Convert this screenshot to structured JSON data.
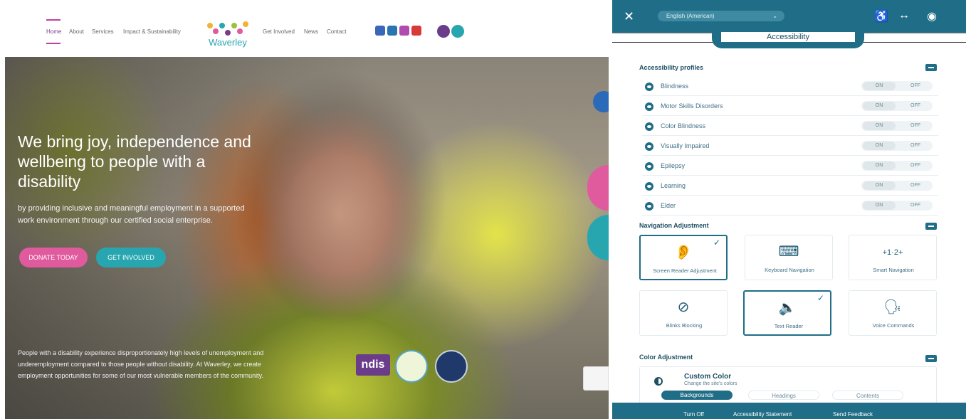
{
  "site": {
    "nav_left": [
      "Home",
      "About",
      "Services",
      "Impact & Sustainability"
    ],
    "nav_right": [
      "Get Involved",
      "News",
      "Contact"
    ],
    "logo_text": "Waverley",
    "hero": {
      "title": "We bring joy, independence and wellbeing to people with a disability",
      "subtitle": "by providing inclusive and meaningful employment in a supported work environment through our certified social enterprise.",
      "donate_label": "DONATE TODAY",
      "involved_label": "GET INVOLVED",
      "bottom_text": "People with a disability experience disproportionately high levels of unemployment and underemployment compared to those people without disability. At Waverley, we create employment opportunities for some of our most vulnerable members of the community.",
      "ndis_label": "ndis"
    },
    "colors": {
      "pink": "#e05a9e",
      "teal": "#27a6b0",
      "purple": "#7a3c8a"
    }
  },
  "panel": {
    "language": "English (American)",
    "tab_label": "Accessibility",
    "profiles_title": "Accessibility profiles",
    "profiles": [
      {
        "label": "Blindness",
        "on": "ON",
        "off": "OFF"
      },
      {
        "label": "Motor Skills Disorders",
        "on": "ON",
        "off": "OFF"
      },
      {
        "label": "Color Blindness",
        "on": "ON",
        "off": "OFF"
      },
      {
        "label": "Visually Impaired",
        "on": "ON",
        "off": "OFF"
      },
      {
        "label": "Epilepsy",
        "on": "ON",
        "off": "OFF"
      },
      {
        "label": "Learning",
        "on": "ON",
        "off": "OFF"
      },
      {
        "label": "Elder",
        "on": "ON",
        "off": "OFF"
      }
    ],
    "navigation_title": "Navigation Adjustment",
    "nav_options": [
      {
        "label": "Screen Reader Adjustment",
        "icon": "ear-icon",
        "selected": true
      },
      {
        "label": "Keyboard Navigation",
        "icon": "keyboard-icon",
        "selected": false
      },
      {
        "label": "Smart Navigation",
        "icon": "smart-nav-icon",
        "selected": false
      },
      {
        "label": "Blinks Blocking",
        "icon": "blink-block-icon",
        "selected": false
      },
      {
        "label": "Text Reader",
        "icon": "speaker-icon",
        "selected": true
      },
      {
        "label": "Voice Commands",
        "icon": "voice-icon",
        "selected": false
      }
    ],
    "smart_nav_glyph": "+1·2+",
    "color_title": "Color Adjustment",
    "custom_color_title": "Custom Color",
    "custom_color_sub": "Change the site's colors",
    "color_tabs": [
      "Backgrounds",
      "Headings",
      "Contents"
    ],
    "footer": [
      "Turn Off",
      "Accessibility Statement",
      "Send Feedback"
    ],
    "colors": {
      "primary": "#1f6d86"
    }
  }
}
